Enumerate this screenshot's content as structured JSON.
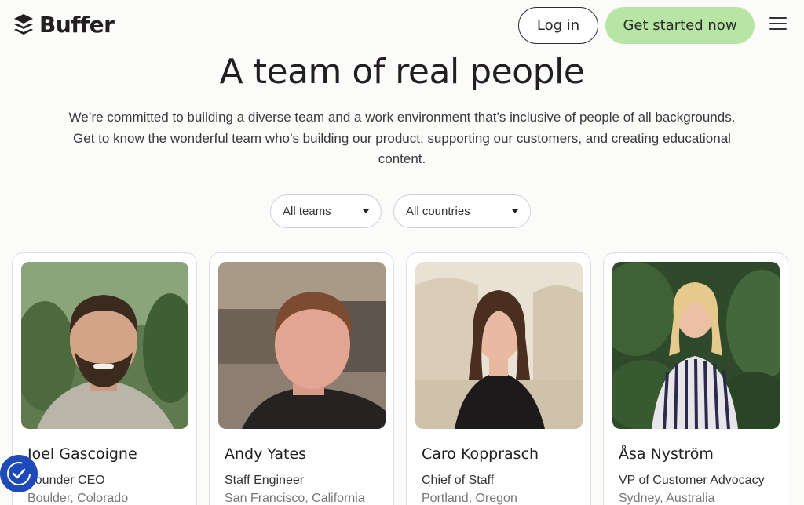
{
  "header": {
    "logo_text": "Buffer",
    "login_label": "Log in",
    "cta_label": "Get started now"
  },
  "hero": {
    "title": "A team of real people",
    "subtitle": "We’re committed to building a diverse team and a work environment that’s inclusive of people of all backgrounds. Get to know the wonderful team who’s building our product, supporting our customers, and creating educational content."
  },
  "filters": {
    "teams_selected": "All teams",
    "countries_selected": "All countries"
  },
  "team": [
    {
      "name": "Joel Gascoigne",
      "role": "Founder CEO",
      "location": "Boulder, Colorado"
    },
    {
      "name": "Andy Yates",
      "role": "Staff Engineer",
      "location": "San Francisco, California"
    },
    {
      "name": "Caro Kopprasch",
      "role": "Chief of Staff",
      "location": "Portland, Oregon"
    },
    {
      "name": "Åsa Nyström",
      "role": "VP of Customer Advocacy",
      "location": "Sydney, Australia"
    }
  ],
  "colors": {
    "cta_bg": "#b7e5a4",
    "page_bg": "#fbfbfa",
    "a11y_bg": "#1e4bb8"
  },
  "icons": [
    "buffer-logo-icon",
    "hamburger-menu-icon",
    "caret-down-icon",
    "accessibility-icon"
  ]
}
